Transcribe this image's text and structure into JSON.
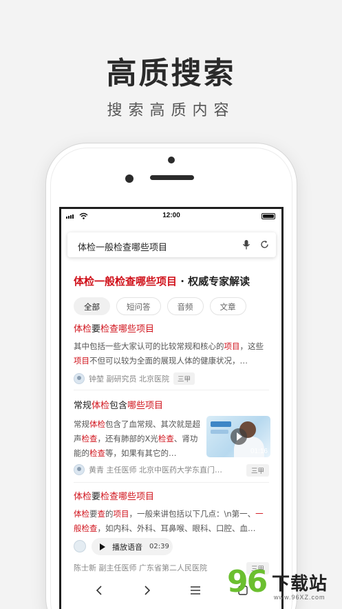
{
  "promo": {
    "headline": "高质搜索",
    "subhead": "搜索高质内容"
  },
  "status_bar": {
    "time": "12:00"
  },
  "search": {
    "query": "体检一般检查哪些项目"
  },
  "result_title": {
    "highlight": "体检一般检查哪些项目",
    "rest": " · 权威专家解读"
  },
  "tabs": [
    {
      "label": "全部",
      "active": true
    },
    {
      "label": "短问答",
      "active": false
    },
    {
      "label": "音频",
      "active": false
    },
    {
      "label": "文章",
      "active": false
    }
  ],
  "results": [
    {
      "title_parts": [
        {
          "text": "体检",
          "hl": true
        },
        {
          "text": "要",
          "hl": false
        },
        {
          "text": "检查哪些项目",
          "hl": true
        }
      ],
      "snippet_parts": [
        {
          "text": "其中包括一些大家认可的比较常规和核心的",
          "hl": false
        },
        {
          "text": "项目",
          "hl": true
        },
        {
          "text": "，这些",
          "hl": false
        },
        {
          "text": "项目",
          "hl": true
        },
        {
          "text": "不但可以较为全面的展现人体的健康状况，…",
          "hl": false
        }
      ],
      "author": "钟堃 副研究员 北京医院",
      "badge": "三甲"
    },
    {
      "title_parts": [
        {
          "text": "常规",
          "hl": false
        },
        {
          "text": "体检",
          "hl": true
        },
        {
          "text": "包含",
          "hl": false
        },
        {
          "text": "哪些项目",
          "hl": true
        }
      ],
      "snippet_parts": [
        {
          "text": "常规",
          "hl": false
        },
        {
          "text": "体检",
          "hl": true
        },
        {
          "text": "包含了血常规、其次就是超声",
          "hl": false
        },
        {
          "text": "检查",
          "hl": true
        },
        {
          "text": "，还有肺部的X光",
          "hl": false
        },
        {
          "text": "检查",
          "hl": true
        },
        {
          "text": "、肾功能的",
          "hl": false
        },
        {
          "text": "检查",
          "hl": true
        },
        {
          "text": "等，如果有其它的…",
          "hl": false
        }
      ],
      "video_duration": "01:16",
      "author": "黄青 主任医师 北京中医药大学东直门…",
      "badge": "三甲"
    },
    {
      "title_parts": [
        {
          "text": "体检",
          "hl": true
        },
        {
          "text": "要",
          "hl": false
        },
        {
          "text": "检查哪些项目",
          "hl": true
        }
      ],
      "snippet_parts": [
        {
          "text": "体检",
          "hl": true
        },
        {
          "text": "要",
          "hl": false
        },
        {
          "text": "查",
          "hl": true
        },
        {
          "text": "的",
          "hl": false
        },
        {
          "text": "项目",
          "hl": true
        },
        {
          "text": "，一般来讲包括以下几点：\\n第一、",
          "hl": false
        },
        {
          "text": "一般检查",
          "hl": true
        },
        {
          "text": "，如内科、外科、耳鼻喉、眼科、口腔、血…",
          "hl": false
        }
      ],
      "voice_label": "播放语音",
      "voice_duration": "02:39",
      "author": "陈士新 副主任医师 广东省第二人民医院",
      "badge": "三甲"
    }
  ],
  "watermark": {
    "number": "96",
    "name": "下载站",
    "url": "www.96XZ.com"
  },
  "colors": {
    "highlight": "#d0121b",
    "brand_green": "#6bbf2f"
  },
  "icons": [
    "mic-icon",
    "refresh-icon",
    "back-icon",
    "forward-icon",
    "menu-icon",
    "tabs-icon",
    "play-icon"
  ]
}
